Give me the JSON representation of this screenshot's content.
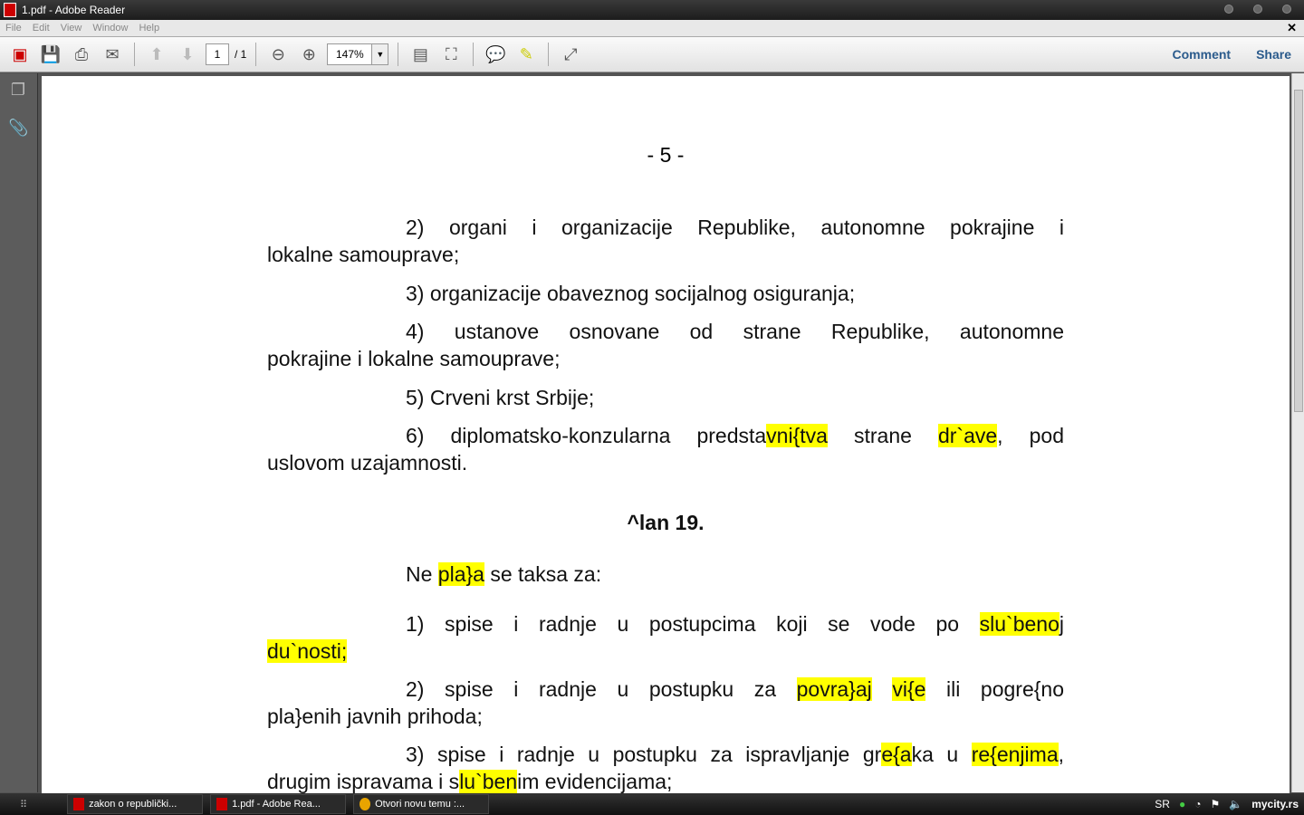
{
  "window": {
    "title": "1.pdf - Adobe Reader"
  },
  "menu": [
    "File",
    "Edit",
    "View",
    "Window",
    "Help"
  ],
  "toolbar": {
    "page_current": "1",
    "page_total": "/ 1",
    "zoom": "147%",
    "comment": "Comment",
    "share": "Share"
  },
  "doc": {
    "page_number": "- 5 -",
    "p1a": "2) organi i organizacije Republike, autonomne pokrajine i",
    "p1b": "lokalne samouprave;",
    "p2": "3) organizacije obaveznog socijalnog osiguranja;",
    "p3a": "4) ustanove osnovane od strane Republike, autonomne",
    "p3b": "pokrajine i lokalne samouprave;",
    "p4": "5) Crveni krst Srbije;",
    "p5a1": "6) diplomatsko-konzularna predsta",
    "p5a2": "vni{tva",
    "p5a3": " strane ",
    "p5a4": "dr`ave",
    ",p5a5": "",
    "p5a6": ", pod",
    "p5b": "uslovom uzajamnosti.",
    "heading": "^lan 19.",
    "p6a": "Ne ",
    "p6b": "pla}a",
    "p6c": " se taksa za:",
    "p7a": "1) spise i radnje u postupcima koji se vode po ",
    "p7b": "slu`beno",
    "p7c": "j",
    "p7d": "du`nosti;",
    "p8a": "2) spise i radnje u postupku za ",
    "p8b": "povra}aj",
    "p8c": " ",
    "p8d": "vi{e",
    "p8e": " ili pogre{no",
    "p8f": "pla}enih javnih prihoda;",
    "p9a": "3) spise i radnje u postupku za ispravljanje gr",
    "p9b": "e{a",
    "p9c": "ka u ",
    "p9d": "re{enjima",
    "p9e": ",",
    "p9f": "drugim ispravama i s",
    "p9g": "lu`ben",
    "p9h": "im evidencijama;"
  },
  "taskbar": {
    "tasks": [
      "zakon o republički...",
      "1.pdf - Adobe Rea...",
      "Otvori novu temu :..."
    ],
    "lang": "SR",
    "clock": "mycity.rs"
  }
}
